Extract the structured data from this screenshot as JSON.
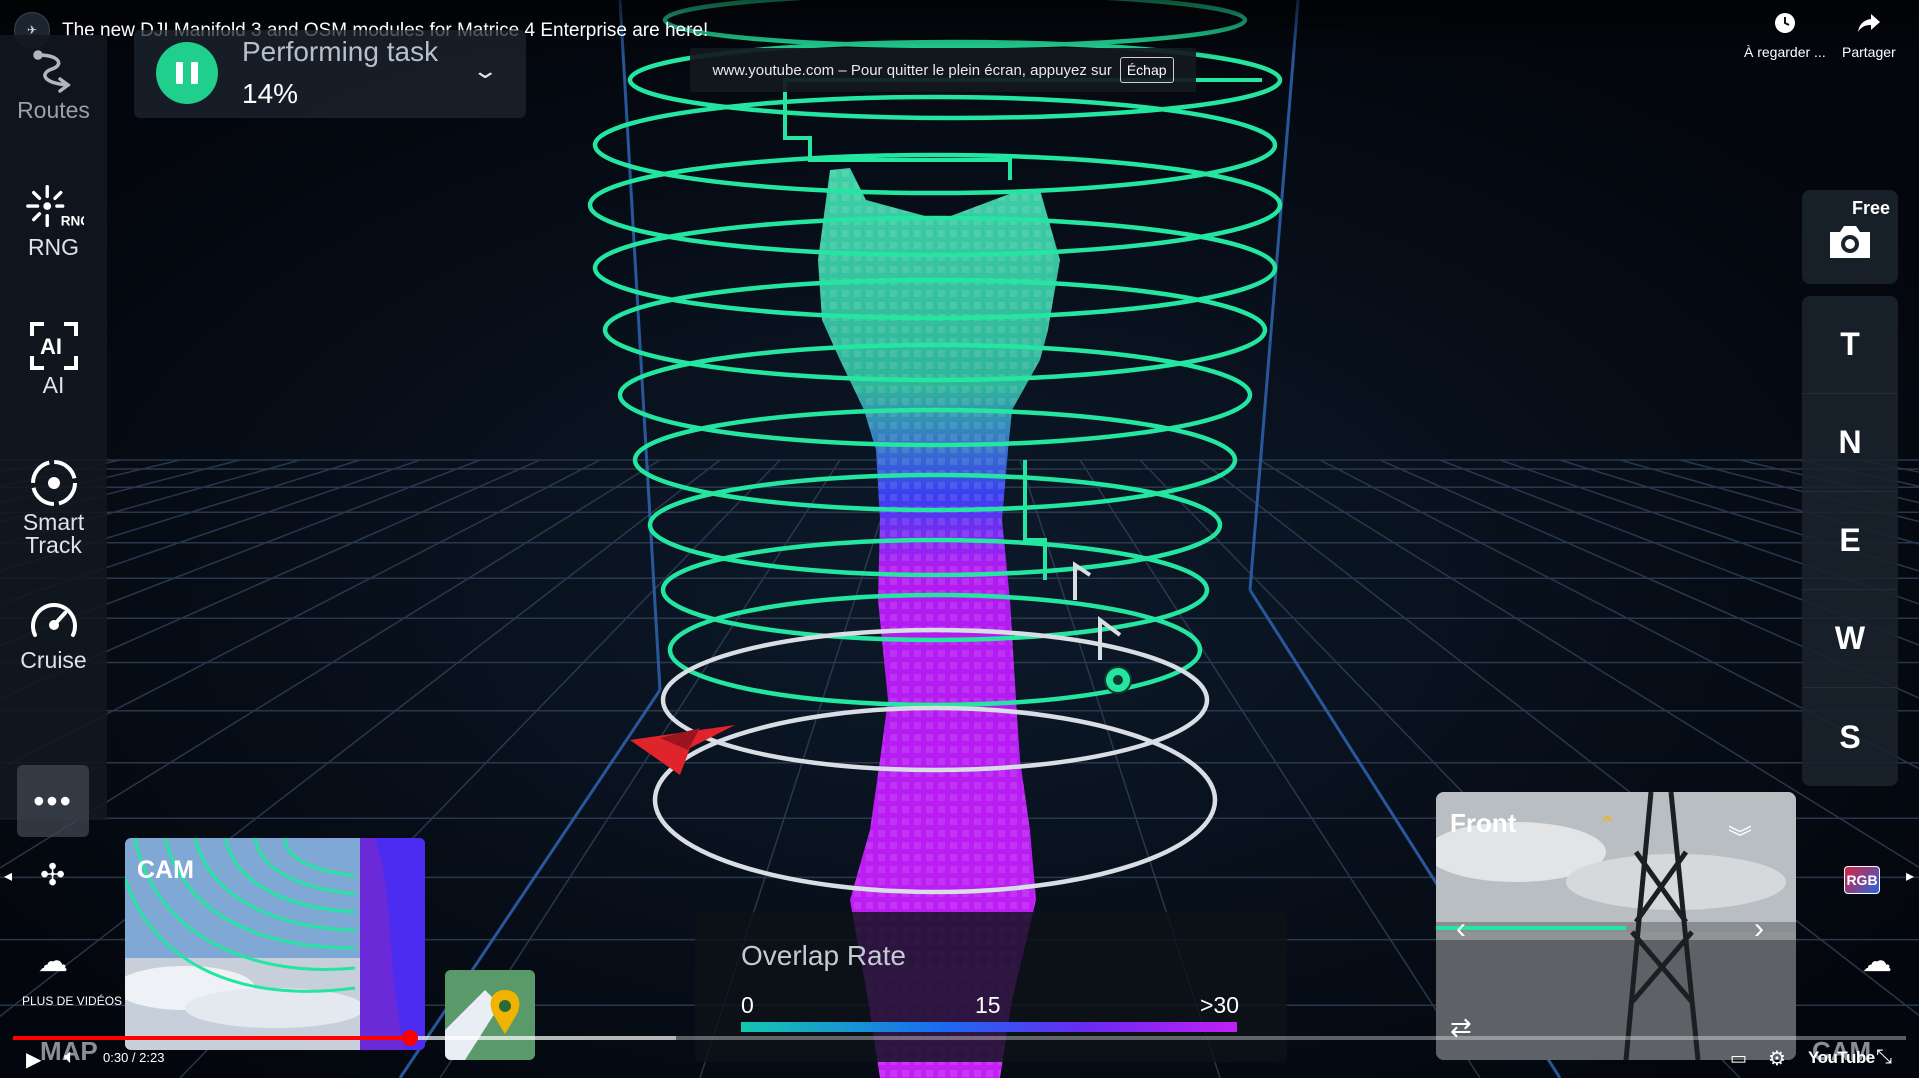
{
  "video": {
    "title": "The new DJI Manifold 3 and OSM modules for Matrice 4 Enterprise are here!",
    "watch_later_label": "À regarder ...",
    "share_label": "Partager",
    "more_videos_label": "PLUS DE VIDÉOS",
    "time": "0:30 / 2:23",
    "progress": 0.2098,
    "buffered": 0.35,
    "logo": "YouTube"
  },
  "fullscreen_notice": {
    "text": "www.youtube.com – Pour quitter le plein écran, appuyez sur",
    "key": "Échap"
  },
  "sidebar": {
    "items": [
      {
        "label": "Routes",
        "icon": "routes-icon"
      },
      {
        "label": "RNG",
        "icon": "rng-icon"
      },
      {
        "label": "AI",
        "icon": "ai-icon"
      },
      {
        "label": "Smart Track",
        "icon": "smart-track-icon"
      },
      {
        "label": "Cruise",
        "icon": "cruise-icon"
      }
    ],
    "more": "•••"
  },
  "task": {
    "label": "Performing task",
    "percent": "14%"
  },
  "camera_mode": {
    "label": "Free"
  },
  "directions": [
    "T",
    "N",
    "E",
    "W",
    "S"
  ],
  "overlap": {
    "title": "Overlap Rate",
    "ticks": [
      "0",
      "15",
      ">30"
    ]
  },
  "cam_thumbnail": {
    "label": "CAM"
  },
  "map_label": "MAP",
  "front_cam": {
    "label": "Front"
  },
  "rgb_badge": "RGB",
  "cam_corner_label": "CAM",
  "colors": {
    "accent_green": "#1fcf8b",
    "ring_green": "#25e6a0",
    "ring_white": "#d9dde4",
    "model_magenta": "#c21ff5",
    "model_blue": "#3a3ef0",
    "progress_red": "#ff0000"
  }
}
